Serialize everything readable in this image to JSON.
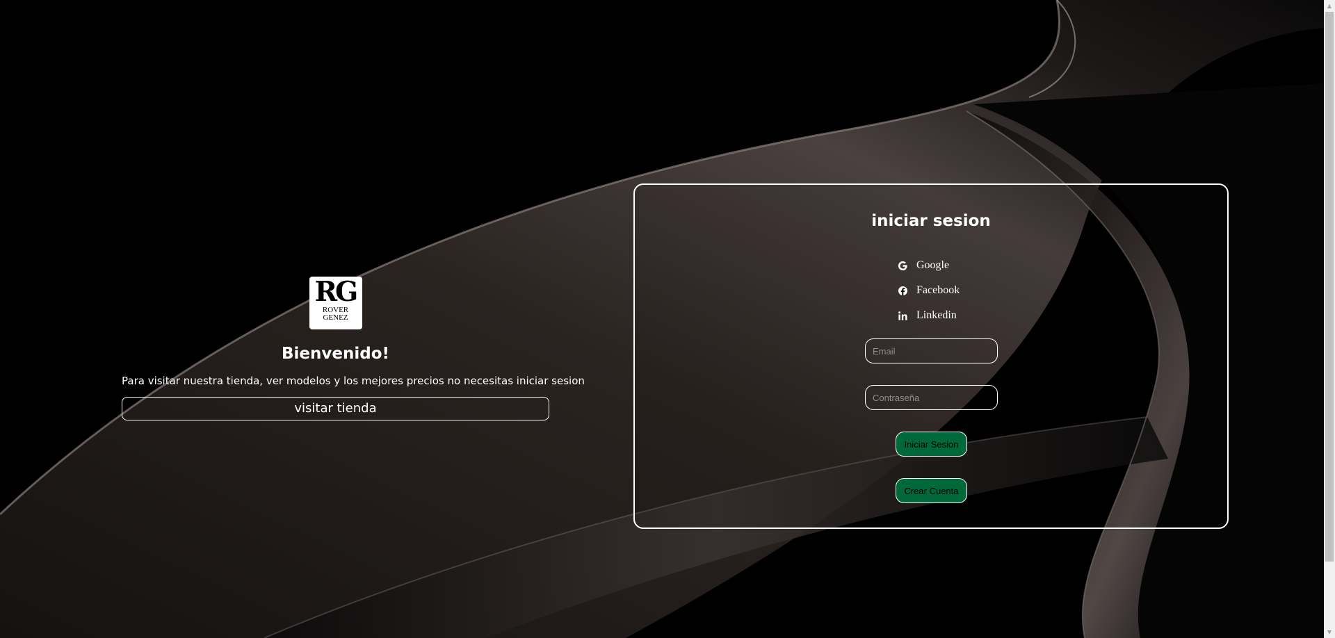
{
  "welcome": {
    "logo_initials": "RG",
    "logo_name_line1": "ROVER",
    "logo_name_line2": "GENEZ",
    "title": "Bienvenido!",
    "text": "Para visitar nuestra tienda, ver modelos y los mejores precios no necesitas iniciar sesion",
    "visit_button": "visitar tienda"
  },
  "login": {
    "title": "iniciar sesion",
    "social": [
      {
        "label": "Google",
        "icon": "google-icon"
      },
      {
        "label": "Facebook",
        "icon": "facebook-icon"
      },
      {
        "label": "Linkedin",
        "icon": "linkedin-icon"
      }
    ],
    "email_placeholder": "Email",
    "password_placeholder": "Contraseña",
    "login_button": "Iniciar Sesion",
    "create_button": "Crear Cuenta"
  },
  "colors": {
    "background": "#000000",
    "accent_button": "#00693a",
    "border": "#ffffff"
  }
}
